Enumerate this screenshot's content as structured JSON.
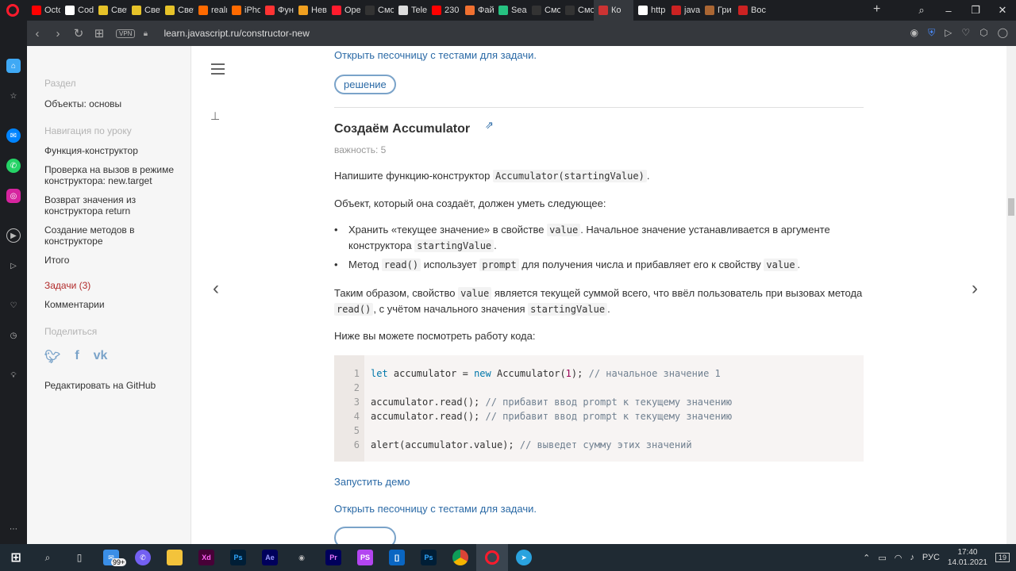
{
  "browser": {
    "tabs": [
      {
        "label": "Octo",
        "color": "#ff0000",
        "icon": "youtube-icon"
      },
      {
        "label": "Code",
        "color": "#ffffff",
        "icon": "doc-icon"
      },
      {
        "label": "Свет",
        "color": "#e6c229",
        "icon": "image-icon"
      },
      {
        "label": "Свет",
        "color": "#e6c229",
        "icon": "image-icon"
      },
      {
        "label": "Свет",
        "color": "#e6c229",
        "icon": "image-icon"
      },
      {
        "label": "realm",
        "color": "#ff6a00",
        "icon": "site-icon"
      },
      {
        "label": "iPho",
        "color": "#ff6a00",
        "icon": "site-icon"
      },
      {
        "label": "Функ",
        "color": "#ff3333",
        "icon": "site-icon"
      },
      {
        "label": "Неви",
        "color": "#f0a020",
        "icon": "site-icon"
      },
      {
        "label": "Ope",
        "color": "#ff1b2d",
        "icon": "opera-icon"
      },
      {
        "label": "Смо",
        "color": "#333333",
        "icon": "hd-icon"
      },
      {
        "label": "Tele",
        "color": "#dddddd",
        "icon": "site-icon"
      },
      {
        "label": "230",
        "color": "#ff0000",
        "icon": "youtube-icon"
      },
      {
        "label": "Фай",
        "color": "#f07030",
        "icon": "site-icon"
      },
      {
        "label": "Sear",
        "color": "#26c281",
        "icon": "vue-icon"
      },
      {
        "label": "Смо",
        "color": "#333333",
        "icon": "hd-icon"
      },
      {
        "label": "Смо",
        "color": "#333333",
        "icon": "hd-icon"
      },
      {
        "label": "Ко",
        "color": "#cc3333",
        "icon": "js-icon"
      },
      {
        "label": "http",
        "color": "#ffffff",
        "icon": "wiki-icon"
      },
      {
        "label": "java",
        "color": "#cc2222",
        "icon": "question-icon"
      },
      {
        "label": "Гри",
        "color": "#aa6633",
        "icon": "site-icon"
      },
      {
        "label": "Вос",
        "color": "#cc2222",
        "icon": "site-icon"
      }
    ],
    "url": "learn.javascript.ru/constructor-new",
    "vpn": "VPN"
  },
  "sidebar": {
    "section_label": "Раздел",
    "section_link": "Объекты: основы",
    "nav_label": "Навигация по уроку",
    "nav_items": [
      "Функция-конструктор",
      "Проверка на вызов в режиме конструктора: new.target",
      "Возврат значения из конструктора return",
      "Создание методов в конструкторе",
      "Итого"
    ],
    "tasks_link": "Задачи (3)",
    "comments_link": "Комментарии",
    "share_label": "Поделиться",
    "github_link": "Редактировать на GitHub"
  },
  "content": {
    "sandbox_link_top": "Открыть песочницу с тестами для задачи.",
    "solution_button": "решение",
    "task_title": "Создаём Accumulator",
    "importance": "важность: 5",
    "p1_text": "Напишите функцию-конструктор ",
    "p1_code": "Accumulator(startingValue)",
    "p2": "Объект, который она создаёт, должен уметь следующее:",
    "b1_a": "Хранить «текущее значение» в свойстве ",
    "b1_code1": "value",
    "b1_b": ". Начальное значение устанавливается в аргументе конструктора ",
    "b1_code2": "startingValue",
    "b2_a": "Метод ",
    "b2_code1": "read()",
    "b2_b": " использует ",
    "b2_code2": "prompt",
    "b2_c": " для получения числа и прибавляет его к свойству ",
    "b2_code3": "value",
    "p3_a": "Таким образом, свойство ",
    "p3_code1": "value",
    "p3_b": " является текущей суммой всего, что ввёл пользователь при вызовах метода ",
    "p3_code2": "read()",
    "p3_c": ", с учётом начального значения ",
    "p3_code3": "startingValue",
    "p4": "Ниже вы можете посмотреть работу кода:",
    "code_lines": [
      "1",
      "2",
      "3",
      "4",
      "5",
      "6"
    ],
    "run_demo": "Запустить демо",
    "sandbox_link_bottom": "Открыть песочницу с тестами для задачи."
  },
  "taskbar": {
    "badge": "99+",
    "lang": "РУС",
    "time": "17:40",
    "date": "14.01.2021",
    "notif": "19"
  }
}
